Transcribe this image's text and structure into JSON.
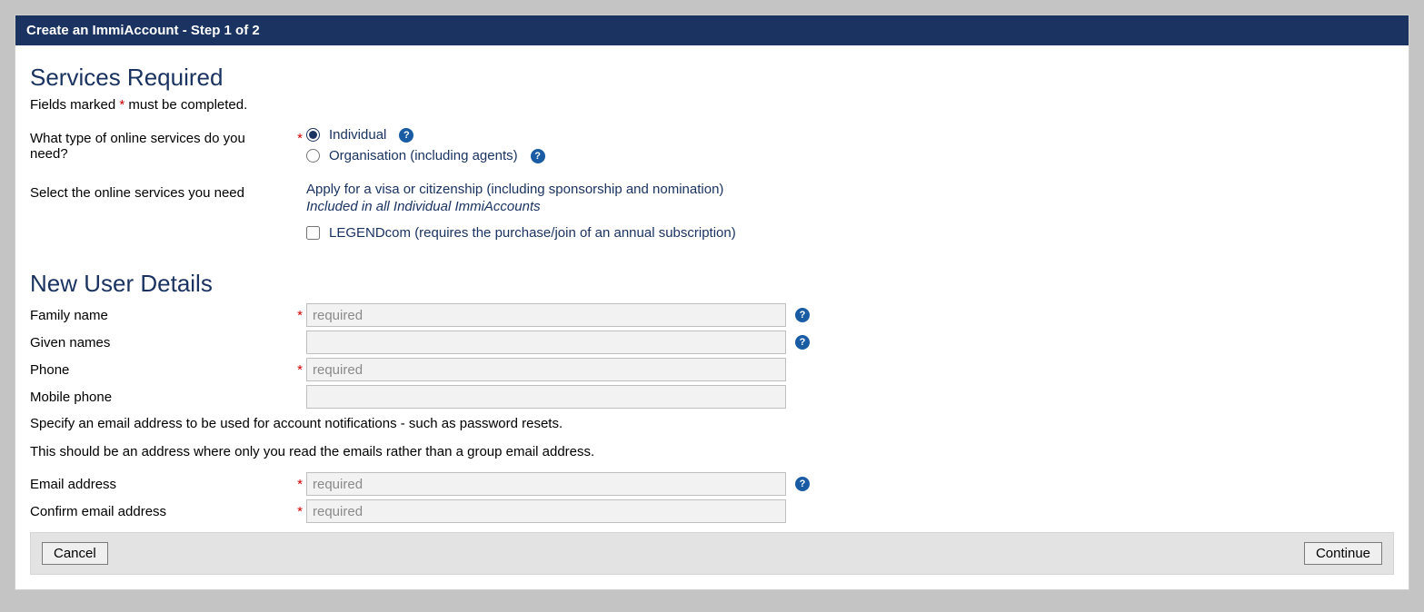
{
  "header": {
    "title": "Create an ImmiAccount - Step 1 of 2"
  },
  "services": {
    "heading": "Services Required",
    "required_hint_prefix": "Fields marked ",
    "required_hint_mark": "*",
    "required_hint_suffix": " must be completed.",
    "type_question": "What type of online services do you need?",
    "type_options": {
      "individual": "Individual",
      "organisation": "Organisation (including agents)"
    },
    "select_label": "Select the online services you need",
    "apply_line": "Apply for a visa or citizenship (including sponsorship and nomination)",
    "apply_sub": "Included in all Individual ImmiAccounts",
    "legendcom": "LEGENDcom (requires the purchase/join of an annual subscription)"
  },
  "user": {
    "heading": "New User Details",
    "family_name_label": "Family name",
    "family_name_placeholder": "required",
    "given_names_label": "Given names",
    "given_names_placeholder": "",
    "phone_label": "Phone",
    "phone_placeholder": "required",
    "mobile_label": "Mobile phone",
    "mobile_placeholder": "",
    "email_note": "Specify an email address to be used for account notifications - such as password resets.",
    "email_note2": "This should be an address where only you read the emails rather than a group email address.",
    "email_label": "Email address",
    "email_placeholder": "required",
    "confirm_email_label": "Confirm email address",
    "confirm_email_placeholder": "required"
  },
  "buttons": {
    "cancel": "Cancel",
    "continue": "Continue"
  },
  "icons": {
    "help_glyph": "?"
  }
}
